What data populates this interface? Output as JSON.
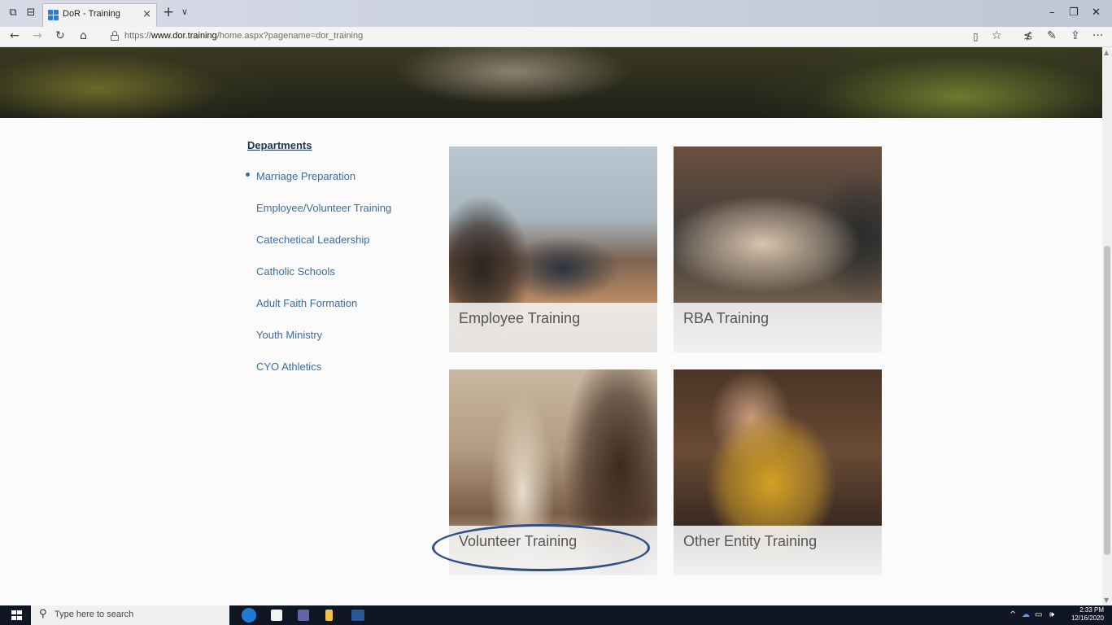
{
  "browser": {
    "tab_title": "DoR - Training",
    "tab_close": "×",
    "new_tab": "+",
    "tab_menu": "∨",
    "url_prefix": "https://",
    "url_host": "www.dor.training",
    "url_path": "/home.aspx?pagename=dor_training",
    "window_controls": {
      "minimize": "–",
      "restore": "❐",
      "close": "✕"
    },
    "nav": {
      "back": "←",
      "forward": "→",
      "refresh": "↻",
      "home": "⌂"
    },
    "toolbar": {
      "reading": "▯",
      "favorite": "☆",
      "favorites_list": "≴",
      "notes": "✎",
      "share": "⇪",
      "more": "···"
    }
  },
  "sidebar": {
    "heading": "Departments",
    "items": [
      {
        "label": "Marriage Preparation",
        "active": true
      },
      {
        "label": "Employee/Volunteer Training",
        "active": false
      },
      {
        "label": "Catechetical Leadership",
        "active": false
      },
      {
        "label": "Catholic Schools",
        "active": false
      },
      {
        "label": "Adult Faith Formation",
        "active": false
      },
      {
        "label": "Youth Ministry",
        "active": false
      },
      {
        "label": "CYO Athletics",
        "active": false
      }
    ]
  },
  "cards": [
    {
      "caption": "Employee Training"
    },
    {
      "caption": "RBA Training"
    },
    {
      "caption": "Volunteer Training"
    },
    {
      "caption": "Other Entity Training"
    }
  ],
  "taskbar": {
    "search_placeholder": "Type here to search",
    "time": "2:33 PM",
    "date": "12/16/2020",
    "tray": {
      "chevron": "^",
      "volume": "🕪"
    }
  },
  "colors": {
    "link": "#3a6d9e",
    "heading": "#1f3550",
    "highlight": "#2f4f86",
    "taskbar": "#101623"
  }
}
